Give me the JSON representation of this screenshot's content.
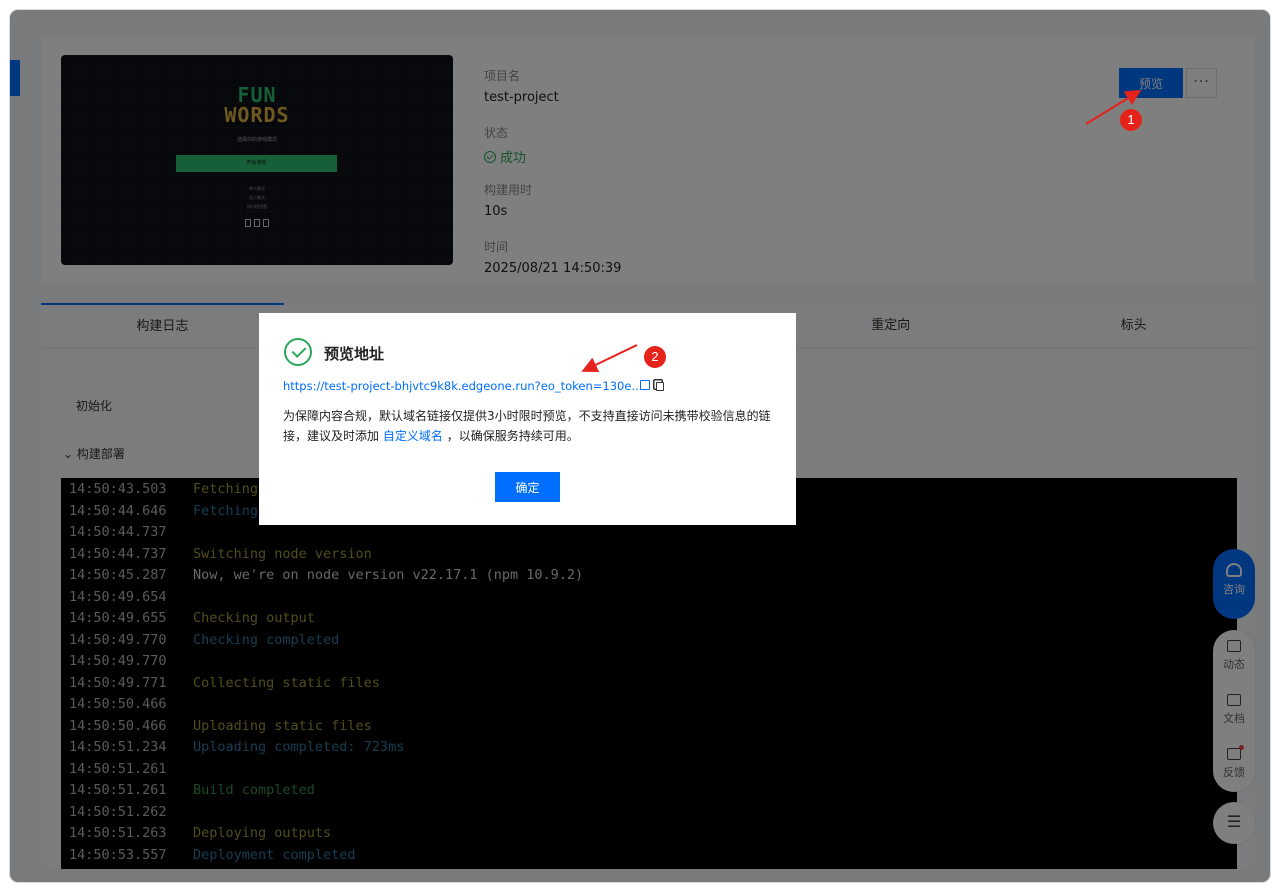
{
  "project": {
    "thumbnail": {
      "title_line1": "FUN",
      "title_line2": "WORDS",
      "subtitle": "选择你的游戏模式",
      "button": "开始游戏",
      "lines": [
        "单人模式",
        "双人模式",
        "排行榜设置"
      ]
    },
    "name_label": "项目名",
    "name_value": "test-project",
    "status_label": "状态",
    "status_value": "成功",
    "build_time_label": "构建用时",
    "build_time_value": "10s",
    "time_label": "时间",
    "time_value": "2025/08/21 14:50:39",
    "preview_button": "预览",
    "more_button": "···"
  },
  "tabs": [
    "构建日志",
    "",
    "",
    "重定向",
    "标头"
  ],
  "log_panel": {
    "init_label": "初始化",
    "deploy_label": "构建部署",
    "lines": [
      {
        "ts": "14:50:43.503",
        "msg": "Fetching",
        "style": "y"
      },
      {
        "ts": "14:50:44.646",
        "msg": "Fetching",
        "style": "b"
      },
      {
        "ts": "14:50:44.737",
        "msg": "",
        "style": "w"
      },
      {
        "ts": "14:50:44.737",
        "msg": "Switching node version",
        "style": "y"
      },
      {
        "ts": "14:50:45.287",
        "msg": "Now, we're on node version v22.17.1 (npm 10.9.2)",
        "style": "w"
      },
      {
        "ts": "14:50:49.654",
        "msg": "",
        "style": "w"
      },
      {
        "ts": "14:50:49.655",
        "msg": "Checking output",
        "style": "y"
      },
      {
        "ts": "14:50:49.770",
        "msg": "Checking completed",
        "style": "b"
      },
      {
        "ts": "14:50:49.770",
        "msg": "",
        "style": "w"
      },
      {
        "ts": "14:50:49.771",
        "msg": "Collecting static files",
        "style": "y"
      },
      {
        "ts": "14:50:50.466",
        "msg": "",
        "style": "w"
      },
      {
        "ts": "14:50:50.466",
        "msg": "Uploading static files",
        "style": "y"
      },
      {
        "ts": "14:50:51.234",
        "msg": "Uploading completed: 723ms",
        "style": "b"
      },
      {
        "ts": "14:50:51.261",
        "msg": "",
        "style": "w"
      },
      {
        "ts": "14:50:51.261",
        "msg": "Build completed",
        "style": "g"
      },
      {
        "ts": "14:50:51.262",
        "msg": "",
        "style": "w"
      },
      {
        "ts": "14:50:51.263",
        "msg": "Deploying outputs",
        "style": "y"
      },
      {
        "ts": "14:50:53.557",
        "msg": "Deployment completed",
        "style": "b"
      }
    ]
  },
  "side_tools": {
    "consult": "咨询",
    "items": [
      {
        "label": "动态",
        "icon": "activity-icon"
      },
      {
        "label": "文档",
        "icon": "book-icon"
      },
      {
        "label": "反馈",
        "icon": "feedback-icon"
      }
    ],
    "menu_icon": "list-icon"
  },
  "modal": {
    "title": "预览地址",
    "url": "https://test-project-bhjvtc9k8k.edgeone.run?eo_token=130e...",
    "desc_part1": "为保障内容合规，默认域名链接仅提供3小时限时预览，不支持直接访问未携带校验信息的链接，建议及时添加",
    "desc_link": "自定义域名",
    "desc_part2": "，以确保服务持续可用。",
    "ok_button": "确定"
  },
  "annotations": {
    "badge1": "1",
    "badge2": "2"
  },
  "colors": {
    "accent": "#006eff",
    "success": "#2aa85a",
    "annotation": "#e5231b"
  }
}
